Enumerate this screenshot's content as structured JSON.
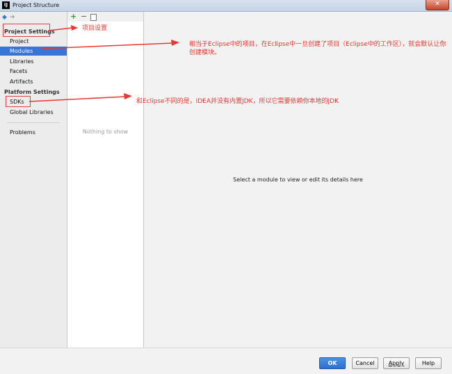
{
  "window": {
    "title": "Project Structure",
    "app_icon_glyph": "IJ",
    "close_glyph": "✕"
  },
  "sidebar": {
    "project_settings_label": "Project Settings",
    "project_items": [
      "Project",
      "Modules",
      "Libraries",
      "Facets",
      "Artifacts"
    ],
    "selected_index": 1,
    "platform_settings_label": "Platform Settings",
    "platform_items": [
      "SDKs",
      "Global Libraries"
    ],
    "extra_items": [
      "Problems"
    ]
  },
  "list_panel": {
    "empty_text": "Nothing to show",
    "add_glyph": "+",
    "remove_glyph": "−"
  },
  "detail": {
    "hint": "Select a module to view or edit its details here"
  },
  "buttons": {
    "ok": "OK",
    "cancel": "Cancel",
    "apply": "Apply",
    "help": "Help"
  },
  "annotations": {
    "project_settings_note": "项目设置",
    "modules_note": "相当于Eclipse中的项目，在Eclipse中一旦创建了项目（Eclipse中的工作区），就会默认让你创建模块。",
    "sdks_note": "和Eclipse不同的是，IDEA并没有内置JDK，所以它需要依赖你本地的JDK"
  },
  "colors": {
    "accent": "#3875d7",
    "annotation": "#e8382f",
    "primary_button": "#2d6fd0"
  }
}
